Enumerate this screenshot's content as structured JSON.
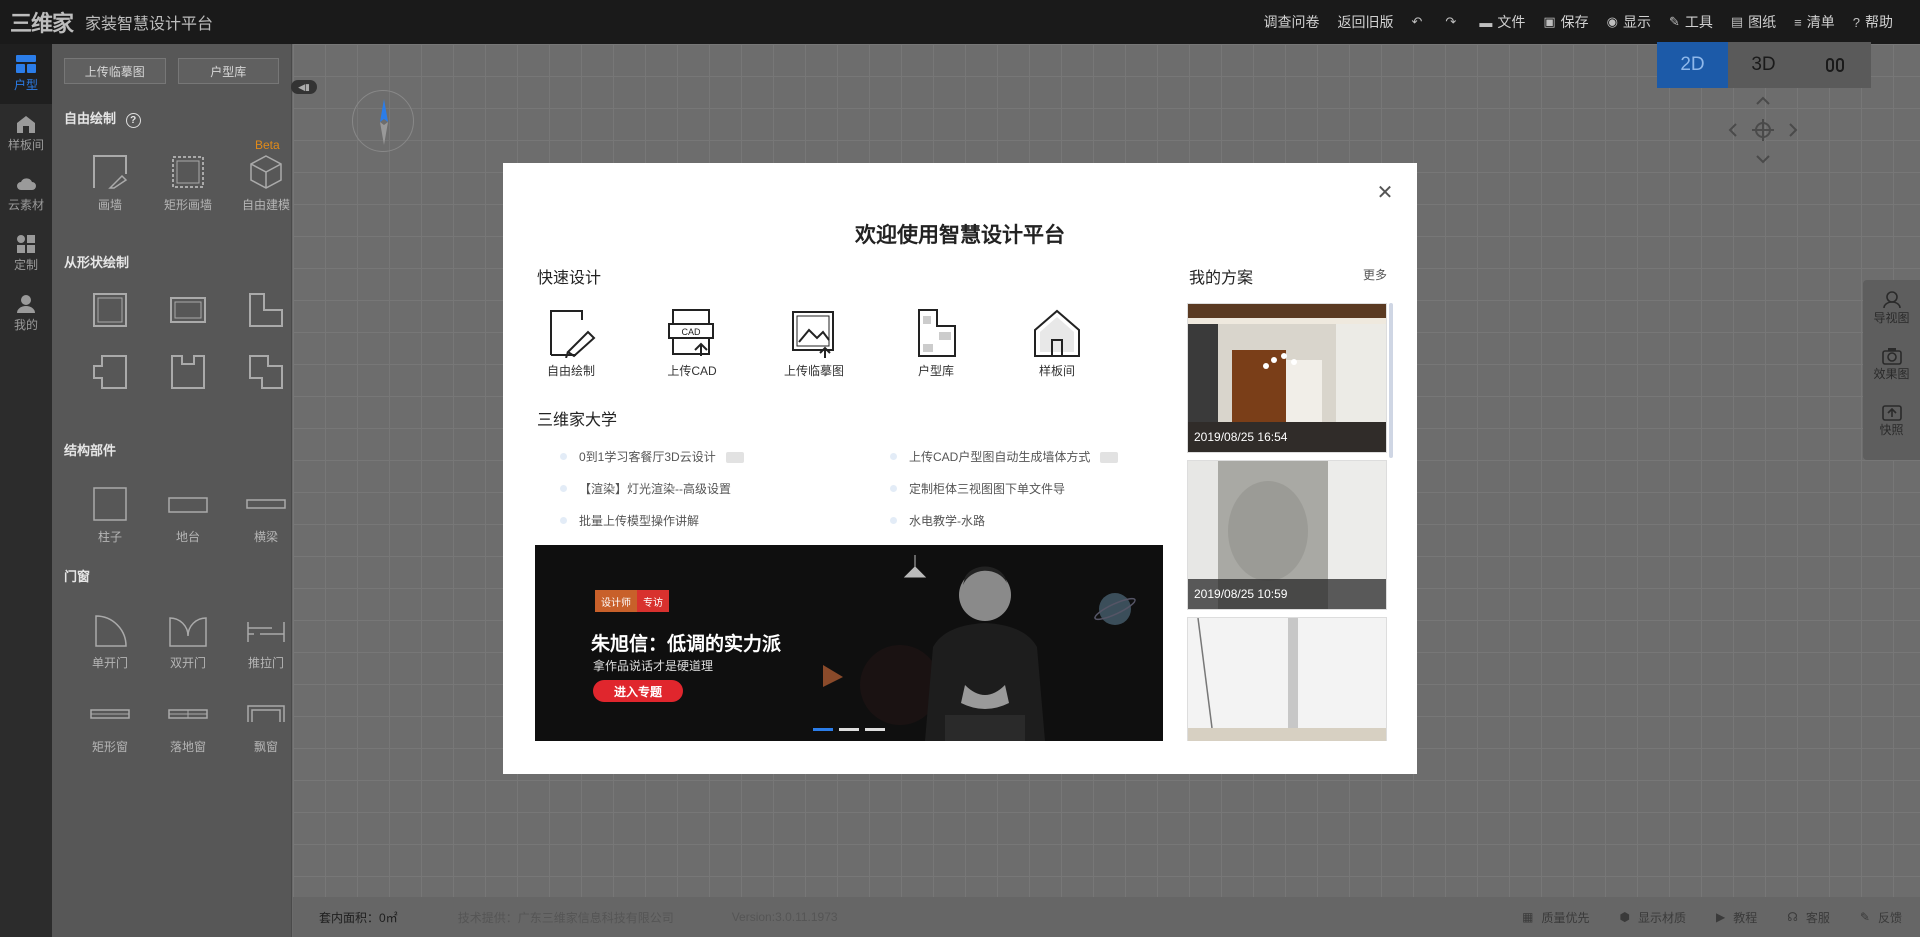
{
  "topbar": {
    "logo": "三维家",
    "title": "家装智慧设计平台",
    "menu": [
      {
        "label": "调查问卷",
        "icon": ""
      },
      {
        "label": "返回旧版",
        "icon": ""
      },
      {
        "label": "",
        "icon": "undo-icon"
      },
      {
        "label": "",
        "icon": "redo-icon"
      },
      {
        "label": "文件",
        "icon": "folder-icon"
      },
      {
        "label": "保存",
        "icon": "save-icon"
      },
      {
        "label": "显示",
        "icon": "eye-icon"
      },
      {
        "label": "工具",
        "icon": "wrench-icon"
      },
      {
        "label": "图纸",
        "icon": "map-icon"
      },
      {
        "label": "清单",
        "icon": "list-icon"
      },
      {
        "label": "帮助",
        "icon": "help-icon"
      }
    ]
  },
  "rail": [
    {
      "label": "户型",
      "icon": "floorplan-icon"
    },
    {
      "label": "样板间",
      "icon": "house-icon"
    },
    {
      "label": "云素材",
      "icon": "cloud-icon"
    },
    {
      "label": "定制",
      "icon": "custom-icon"
    },
    {
      "label": "我的",
      "icon": "user-icon"
    }
  ],
  "panel": {
    "upload_btn": "上传临摹图",
    "library_btn": "户型库",
    "free_draw": {
      "title": "自由绘制",
      "beta": "Beta",
      "tools": [
        "画墙",
        "矩形画墙",
        "自由建模"
      ]
    },
    "shape_draw": {
      "title": "从形状绘制"
    },
    "structure": {
      "title": "结构部件",
      "tools": [
        "柱子",
        "地台",
        "横梁"
      ]
    },
    "doors": {
      "title": "门窗",
      "tools": [
        "单开门",
        "双开门",
        "推拉门",
        "矩形窗",
        "落地窗",
        "飘窗"
      ]
    }
  },
  "view": {
    "modes": [
      "2D",
      "3D",
      "VR"
    ],
    "active": "2D"
  },
  "rightbar": [
    {
      "label": "导视图",
      "icon": "viewpoint-icon"
    },
    {
      "label": "效果图",
      "icon": "camera-icon"
    },
    {
      "label": "快照",
      "icon": "snapshot-icon"
    }
  ],
  "status": {
    "area": "套内面积：0㎡",
    "provider": "技术提供：广东三维家信息科技有限公司",
    "version": "Version:3.0.11.1973",
    "right": [
      "质量优先",
      "显示材质",
      "教程",
      "客服",
      "反馈"
    ]
  },
  "modal": {
    "title": "欢迎使用智慧设计平台",
    "quick_title": "快速设计",
    "quick": [
      "自由绘制",
      "上传CAD",
      "上传临摹图",
      "户型库",
      "样板间"
    ],
    "cad_tag": "CAD",
    "uni_title": "三维家大学",
    "uni_left": [
      "0到1学习客餐厅3D云设计",
      "【渲染】灯光渲染--高级设置",
      "批量上传模型操作讲解"
    ],
    "uni_right": [
      "上传CAD户型图自动生成墙体方式",
      "定制柜体三视图图下单文件导",
      "水电教学-水路"
    ],
    "banner": {
      "tag1": "设计师",
      "tag2": "专访",
      "headline": "朱旭信：低调的实力派",
      "sub": "拿作品说话才是硬道理",
      "button": "进入专题",
      "slide_count": 3,
      "active_slide": 0
    },
    "plans_title": "我的方案",
    "more": "更多",
    "plans": [
      {
        "date": "2019/08/25 16:54"
      },
      {
        "date": "2019/08/25 10:59"
      },
      {
        "date": ""
      }
    ]
  }
}
